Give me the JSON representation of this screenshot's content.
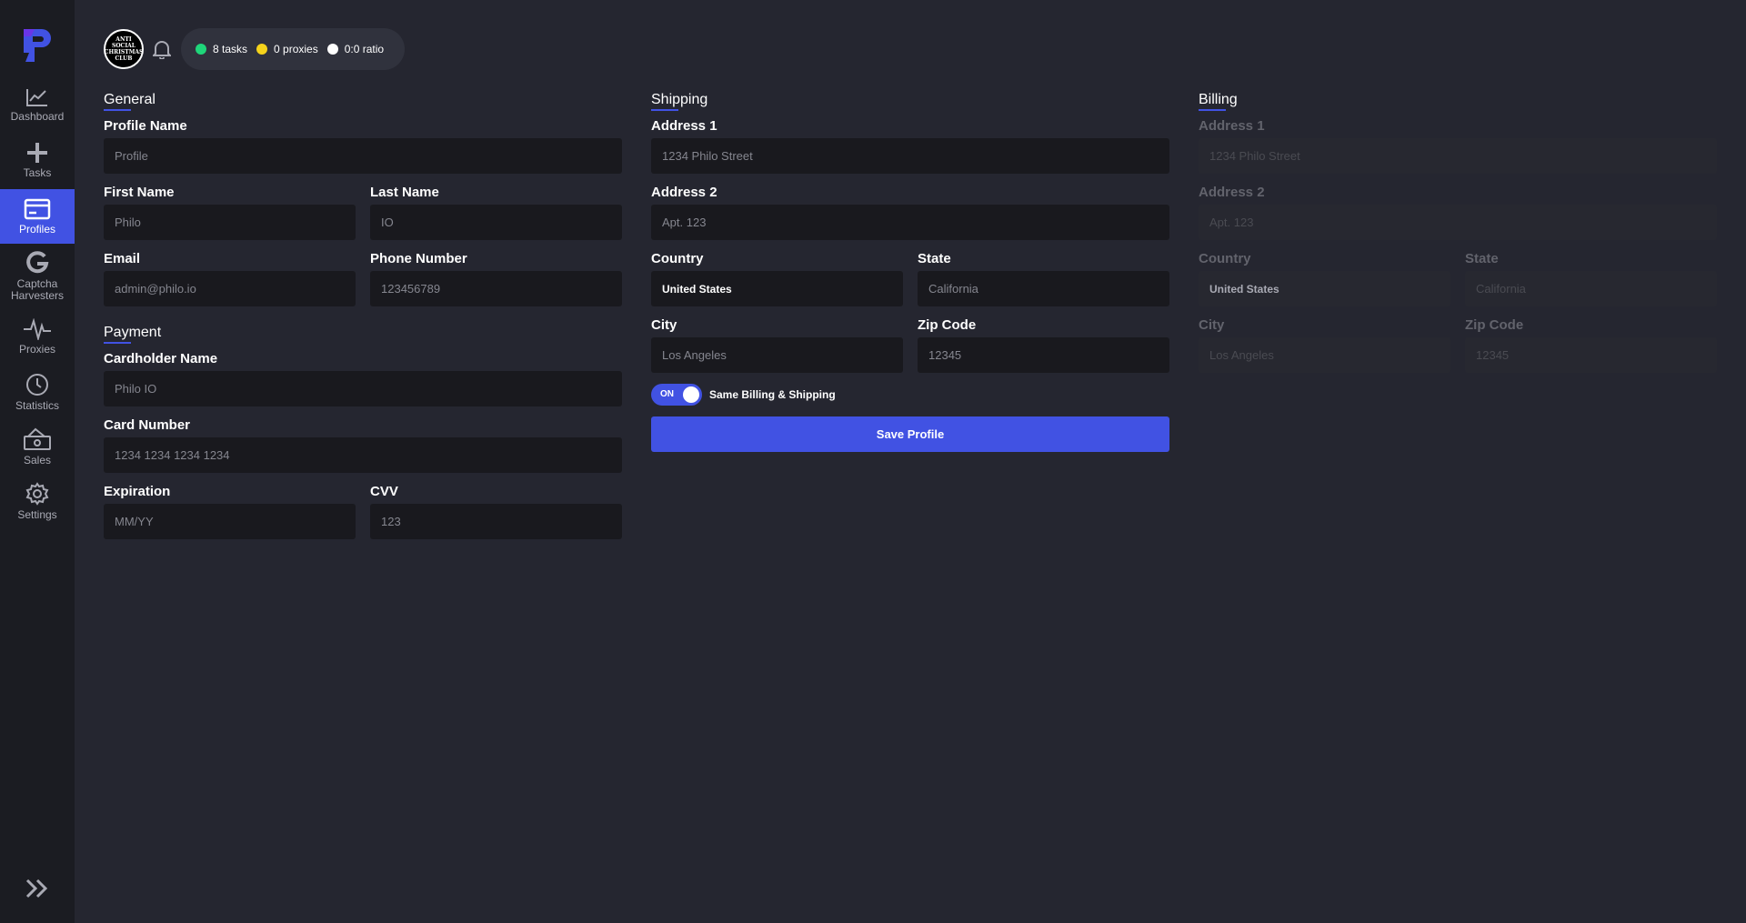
{
  "sidebar": {
    "items": [
      {
        "label": "Dashboard",
        "icon": "chart-line-icon"
      },
      {
        "label": "Tasks",
        "icon": "plus-icon"
      },
      {
        "label": "Profiles",
        "icon": "credit-card-icon"
      },
      {
        "label": "Captcha Harvesters",
        "icon": "google-g-icon"
      },
      {
        "label": "Proxies",
        "icon": "pulse-icon"
      },
      {
        "label": "Statistics",
        "icon": "clock-icon"
      },
      {
        "label": "Sales",
        "icon": "money-icon"
      },
      {
        "label": "Settings",
        "icon": "gear-icon"
      }
    ],
    "active": "Profiles",
    "accent": "#4152e3"
  },
  "header": {
    "avatar_text": "ANTI SOCIAL CHRISTMAS CLUB",
    "stats": [
      {
        "label": "8 tasks",
        "color": "#1fd67a"
      },
      {
        "label": "0 proxies",
        "color": "#f5d31b"
      },
      {
        "label": "0:0 ratio",
        "color": "#ffffff"
      }
    ]
  },
  "general": {
    "title": "General",
    "profile_name_label": "Profile Name",
    "profile_name_placeholder": "Profile",
    "first_name_label": "First Name",
    "first_name_placeholder": "Philo",
    "last_name_label": "Last Name",
    "last_name_placeholder": "IO",
    "email_label": "Email",
    "email_placeholder": "admin@philo.io",
    "phone_label": "Phone Number",
    "phone_placeholder": "123456789"
  },
  "payment": {
    "title": "Payment",
    "cardholder_label": "Cardholder Name",
    "cardholder_placeholder": "Philo IO",
    "card_number_label": "Card Number",
    "card_number_placeholder": "1234 1234 1234 1234",
    "expiration_label": "Expiration",
    "expiration_placeholder": "MM/YY",
    "cvv_label": "CVV",
    "cvv_placeholder": "123"
  },
  "shipping": {
    "title": "Shipping",
    "address1_label": "Address 1",
    "address1_placeholder": "1234 Philo Street",
    "address2_label": "Address 2",
    "address2_placeholder": "Apt. 123",
    "country_label": "Country",
    "country_value": "United States",
    "state_label": "State",
    "state_placeholder": "California",
    "city_label": "City",
    "city_placeholder": "Los Angeles",
    "zip_label": "Zip Code",
    "zip_placeholder": "12345"
  },
  "toggle": {
    "state": "ON",
    "label": "Same Billing & Shipping"
  },
  "save_button": "Save Profile",
  "billing": {
    "title": "Billing",
    "address1_label": "Address 1",
    "address1_placeholder": "1234 Philo Street",
    "address2_label": "Address 2",
    "address2_placeholder": "Apt. 123",
    "country_label": "Country",
    "country_value": "United States",
    "state_label": "State",
    "state_placeholder": "California",
    "city_label": "City",
    "city_placeholder": "Los Angeles",
    "zip_label": "Zip Code",
    "zip_placeholder": "12345"
  }
}
